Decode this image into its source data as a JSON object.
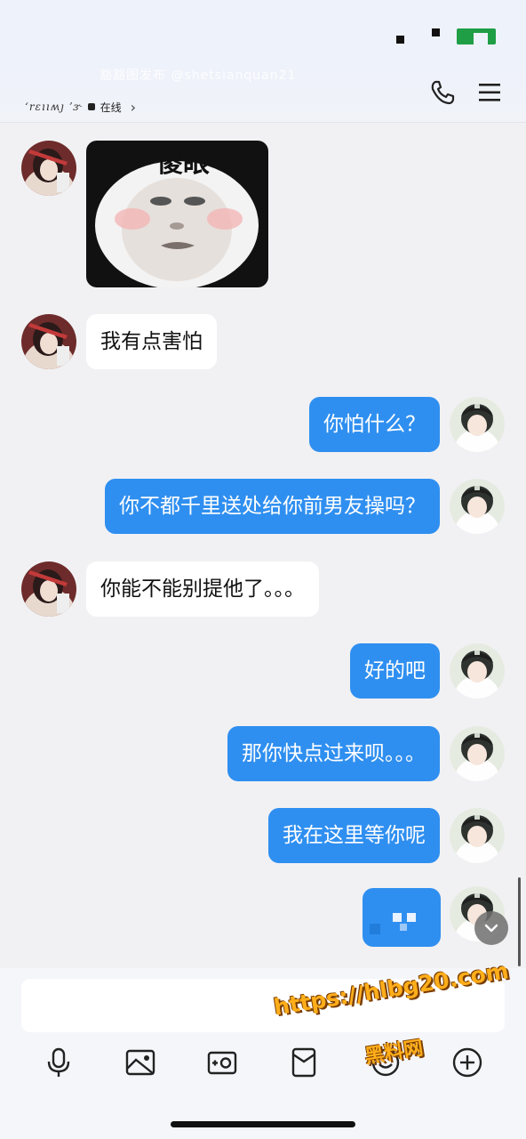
{
  "status_bar": {
    "battery_color": "#1f9e46"
  },
  "header": {
    "contact_name": "ʻrɛııʍȷ ʼɝ",
    "online_status": "在线",
    "watermark": "豁豁图发布 @shetsianquan21",
    "icons": {
      "call": "phone-icon",
      "menu": "hamburger-menu-icon"
    }
  },
  "colors": {
    "outgoing_bubble": "#2f8ff0",
    "incoming_bubble": "#ffffff",
    "background": "#f1f1f3"
  },
  "messages": [
    {
      "side": "left",
      "type": "sticker",
      "caption": "傻眼"
    },
    {
      "side": "left",
      "type": "text",
      "text": "我有点害怕"
    },
    {
      "side": "right",
      "type": "text",
      "text": "你怕什么？"
    },
    {
      "side": "right",
      "type": "text",
      "text": "你不都千里送处给你前男友操吗？"
    },
    {
      "side": "left",
      "type": "text",
      "text": "你能不能别提他了。。。"
    },
    {
      "side": "right",
      "type": "text",
      "text": "好的吧"
    },
    {
      "side": "right",
      "type": "text",
      "text": "那你快点过来呗。。。"
    },
    {
      "side": "right",
      "type": "text",
      "text": "我在这里等你呢"
    },
    {
      "side": "right",
      "type": "emoji",
      "icon": "emoji-sticker-icon"
    }
  ],
  "input": {
    "placeholder": ""
  },
  "toolbar": [
    "voice-icon",
    "image-icon",
    "camera-icon",
    "red-packet-icon",
    "emoji-icon",
    "plus-icon"
  ],
  "watermark_bottom": {
    "url": "https://hlbg20.com",
    "cn": "黑料网"
  }
}
